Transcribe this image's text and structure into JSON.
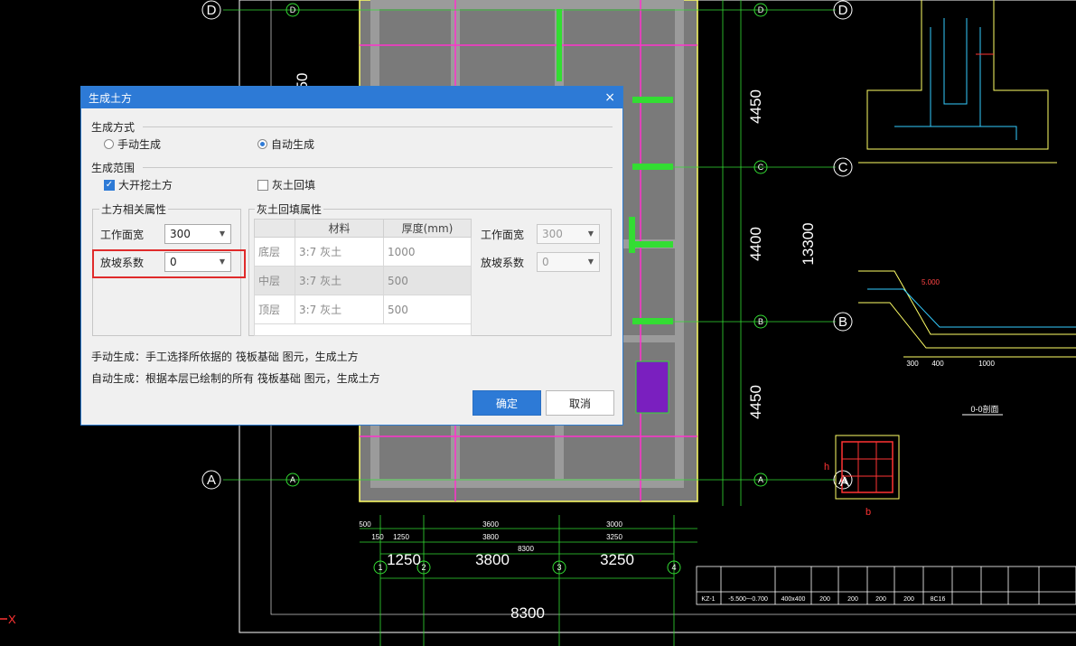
{
  "dialog": {
    "title": "生成土方",
    "close_icon": "×",
    "mode_section": "生成方式",
    "mode_manual": "手动生成",
    "mode_auto": "自动生成",
    "mode_selected": "自动生成",
    "range_section": "生成范围",
    "range_excavation": "大开挖土方",
    "range_excavation_checked": true,
    "range_backfill": "灰土回填",
    "range_backfill_checked": false,
    "earth_group": "土方相关属性",
    "earth_work_width_label": "工作面宽",
    "earth_work_width_value": "300",
    "earth_slope_label": "放坡系数",
    "earth_slope_value": "0",
    "fill_group": "灰土回填属性",
    "fill_table": {
      "headers": [
        "",
        "材料",
        "厚度(mm)"
      ],
      "rows": [
        [
          "底层",
          "3:7 灰土",
          "1000"
        ],
        [
          "中层",
          "3:7 灰土",
          "500"
        ],
        [
          "顶层",
          "3:7 灰土",
          "500"
        ]
      ]
    },
    "fill_work_width_label": "工作面宽",
    "fill_work_width_value": "300",
    "fill_slope_label": "放坡系数",
    "fill_slope_value": "0",
    "hint_manual": "手动生成：手工选择所依据的 筏板基础 图元，生成土方",
    "hint_auto": "自动生成：根据本层已绘制的所有 筏板基础 图元，生成土方",
    "ok_label": "确定",
    "cancel_label": "取消"
  },
  "cad": {
    "axis_labels": [
      "D",
      "C",
      "B",
      "A",
      "1",
      "2",
      "3",
      "4"
    ],
    "dims_vertical": [
      "4450",
      "4400",
      "4450",
      "13300",
      "50"
    ],
    "dims_horizontal": [
      "1250",
      "3800",
      "3250",
      "8300"
    ],
    "small_dims": [
      "500",
      "150",
      "1250",
      "3600",
      "3800",
      "3000",
      "3250",
      "8300",
      "300",
      "400",
      "1000",
      "5.000"
    ],
    "x_axis_label": "X",
    "detail_title": "0-0剖面",
    "detail_a": "A",
    "detail_h": "h",
    "detail_b": "b",
    "table_row": [
      "KZ-1",
      "-5.500~-0.700",
      "400x400",
      "200",
      "200",
      "200",
      "200",
      "8C16"
    ]
  }
}
